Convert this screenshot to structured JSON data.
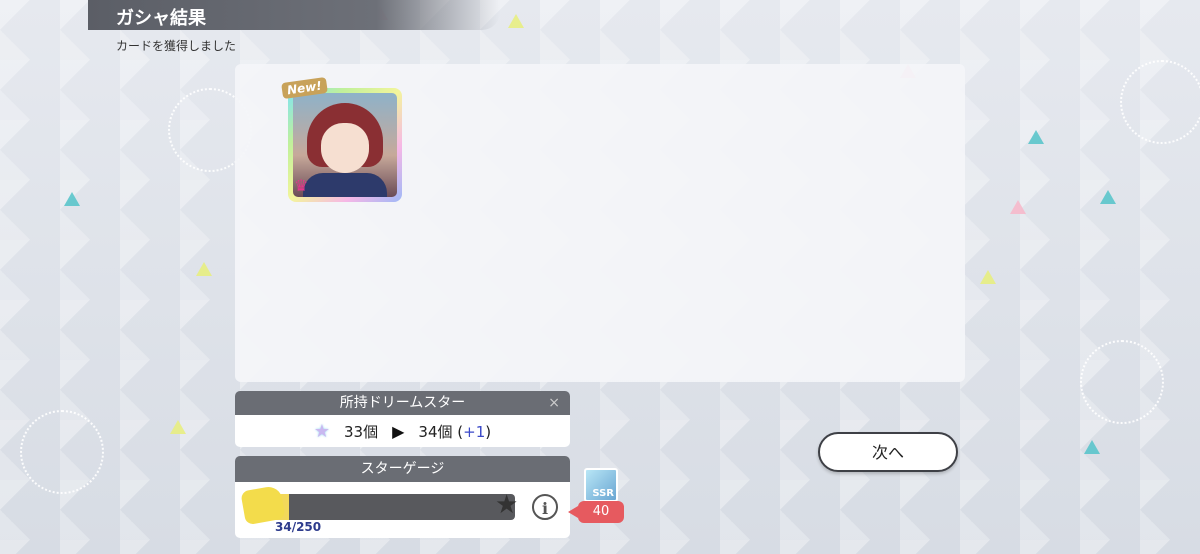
{
  "header": {
    "title": "ガシャ結果",
    "subtitle": "カードを獲得しました"
  },
  "result": {
    "card_new_label": "New!"
  },
  "dream_star": {
    "title": "所持ドリームスター",
    "close_symbol": "×",
    "before": "33個",
    "after": "34個",
    "delta_open": "(",
    "delta": "+1",
    "delta_close": ")"
  },
  "star_gauge": {
    "title": "スターゲージ",
    "current": "34",
    "max": "250",
    "count_text": "34/250",
    "progress_fraction": 0.136,
    "reward_rarity": "SSR",
    "reward_count": "40"
  },
  "actions": {
    "next_label": "次へ"
  },
  "colors": {
    "header_bg": "#5b5e66",
    "panel_header_bg": "#6a6d74",
    "badge_red": "#e65a5f",
    "delta_blue": "#3b49c8",
    "crown_pink": "#e4358c"
  },
  "icons": [
    "crown-icon",
    "star-icon",
    "arrow-icon",
    "close-icon",
    "info-icon",
    "mascot-icon",
    "gauge-star-icon"
  ]
}
